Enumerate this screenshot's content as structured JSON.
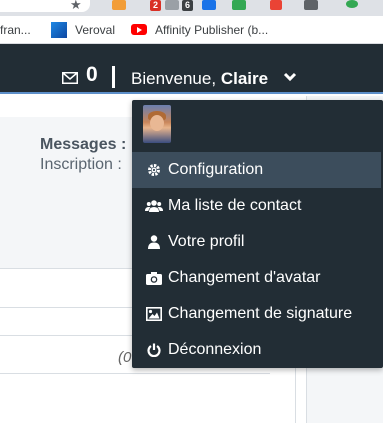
{
  "browser": {
    "bookmarks": [
      {
        "label": "fran...",
        "icon": "page-icon"
      },
      {
        "label": "Veroval",
        "icon": "veroval-icon"
      },
      {
        "label": "Affinity Publisher (b...",
        "icon": "youtube-icon"
      }
    ],
    "extension_badges": [
      "2",
      "6"
    ]
  },
  "navbar": {
    "mail_count": "0",
    "greeting": "Bienvenue,",
    "user_name": "Claire",
    "accent_color": "#5d8fc9",
    "bg_color": "#222d35"
  },
  "profile": {
    "messages_label": "Messages :",
    "inscription_label": "Inscription :",
    "paren_text": "(0"
  },
  "dropdown": {
    "items": [
      {
        "label": "Configuration",
        "icon": "gear-icon",
        "active": true
      },
      {
        "label": "Ma liste de contact",
        "icon": "users-icon",
        "active": false
      },
      {
        "label": "Votre profil",
        "icon": "user-icon",
        "active": false
      },
      {
        "label": "Changement d'avatar",
        "icon": "camera-icon",
        "active": false
      },
      {
        "label": "Changement de signature",
        "icon": "image-icon",
        "active": false
      },
      {
        "label": "Déconnexion",
        "icon": "power-icon",
        "active": false
      }
    ]
  }
}
